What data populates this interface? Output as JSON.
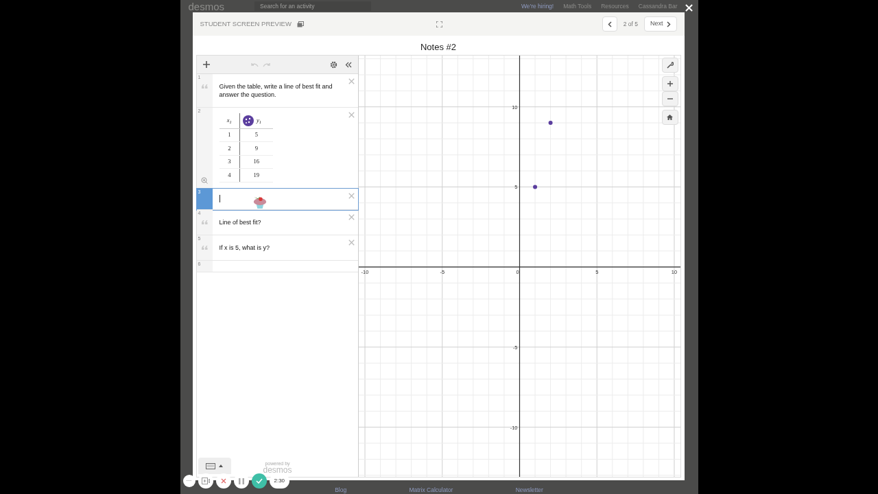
{
  "background_page": {
    "logo": "desmos",
    "search_placeholder": "Search for an activity",
    "nav": [
      "We're hiring!",
      "Math Tools",
      "Resources",
      "Cassandra Bar"
    ],
    "footer_links": [
      "Blog",
      "Matrix Calculator",
      "Newsletter"
    ]
  },
  "modal": {
    "title": "STUDENT SCREEN PREVIEW",
    "page": "2 of 5",
    "next": "Next",
    "screen_title": "Notes #2"
  },
  "expressions": [
    {
      "number": "1",
      "kind": "note",
      "text": "Given the table, write a line of best fit and answer the question.",
      "selected": false
    },
    {
      "number": "2",
      "kind": "table",
      "color": "#5b3e9e",
      "columns": [
        "x$_{1}$",
        "y$_{1}$"
      ],
      "rows": [
        [
          "1",
          "5"
        ],
        [
          "2",
          "9"
        ],
        [
          "3",
          "16"
        ],
        [
          "4",
          "19"
        ]
      ],
      "selected": false
    },
    {
      "number": "3",
      "kind": "input",
      "selected": true
    },
    {
      "number": "4",
      "kind": "note",
      "text": "Line of best fit?",
      "selected": false
    },
    {
      "number": "5",
      "kind": "note",
      "text": "If x is 5, what is y?",
      "selected": false
    },
    {
      "number": "6",
      "kind": "empty",
      "selected": false
    }
  ],
  "branding": {
    "line1": "powered by",
    "line2": "desmos"
  },
  "player": {
    "more": "···",
    "timer": "2:30"
  },
  "graph": {
    "chart_data": {
      "type": "scatter",
      "x": [
        1,
        2
      ],
      "series": [
        {
          "color": "#5b3e9e",
          "values": [
            5,
            9
          ]
        }
      ],
      "grid": true,
      "xlim": [
        -10.4,
        10.4
      ],
      "ylim": [
        -13.1,
        13.2
      ],
      "xticks": [
        -10,
        -5,
        0,
        5,
        10
      ],
      "yticks": [
        -10,
        -5,
        5,
        10
      ]
    }
  }
}
